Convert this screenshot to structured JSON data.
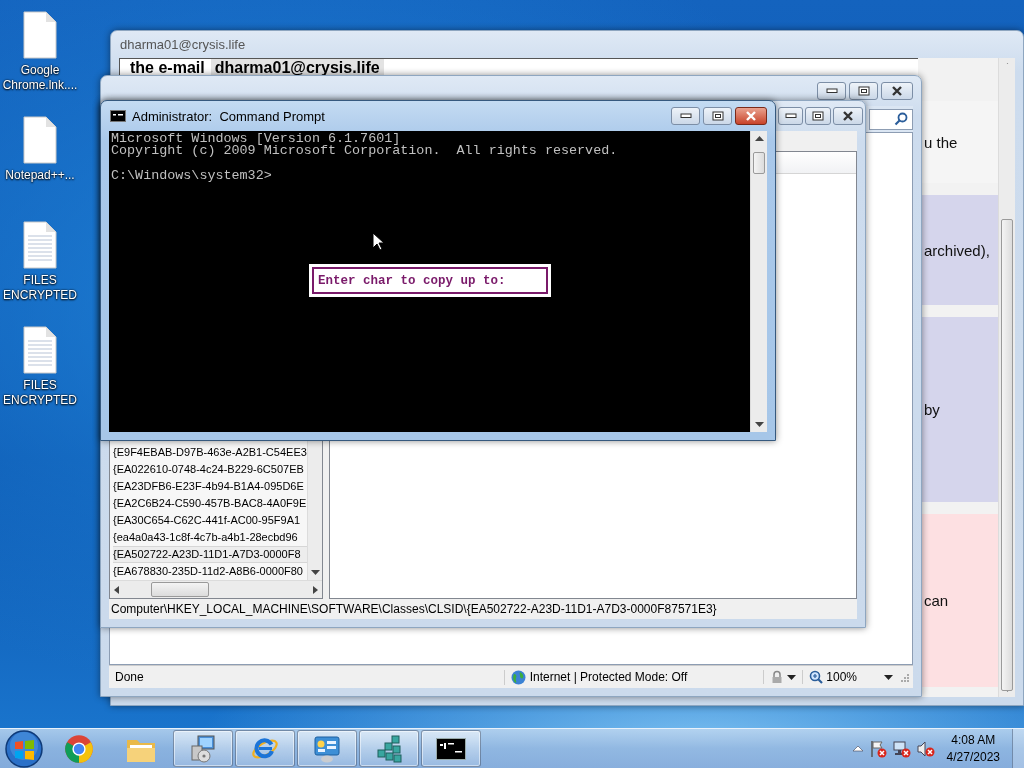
{
  "desktop_icons": [
    {
      "label": "Google Chrome.lnk....",
      "kind": "file"
    },
    {
      "label": "Notepad++...",
      "kind": "file"
    },
    {
      "label": "FILES ENCRYPTED",
      "kind": "text"
    },
    {
      "label": "FILES ENCRYPTED",
      "kind": "text"
    }
  ],
  "page_window": {
    "title": "dharma01@crysis.life",
    "banner_label": "the e-mail",
    "banner_email": "dharma01@crysis.life",
    "fragments": [
      {
        "text": "u the",
        "color": "#f5f5f5"
      },
      {
        "text": "archived),",
        "color": "#d5d5ec"
      },
      {
        "text": "by",
        "color": "#d5d5ec"
      },
      {
        "text": "can",
        "color": "#fde0e2"
      }
    ]
  },
  "browser_window": {
    "status": "Done",
    "zone": "Internet | Protected Mode: Off",
    "zoom": "100%"
  },
  "registry_window": {
    "keys": [
      {
        "name": "{E9F4EBAB-D97B-463e-A2B1-C54EE3",
        "selected": false
      },
      {
        "name": "{EA022610-0748-4c24-B229-6C507EB",
        "selected": false
      },
      {
        "name": "{EA23DFB6-E23F-4b94-B1A4-095D6E",
        "selected": false
      },
      {
        "name": "{EA2C6B24-C590-457B-BAC8-4A0F9E",
        "selected": false
      },
      {
        "name": "{EA30C654-C62C-441f-AC00-95F9A1",
        "selected": false
      },
      {
        "name": "{ea4a0a43-1c8f-4c7b-a4b1-28ecbd96",
        "selected": false
      },
      {
        "name": "{EA502722-A23D-11D1-A7D3-0000F8",
        "selected": true
      },
      {
        "name": "{EA678830-235D-11d2-A8B6-0000F80",
        "selected": false
      }
    ],
    "path": "Computer\\HKEY_LOCAL_MACHINE\\SOFTWARE\\Classes\\CLSID\\{EA502722-A23D-11D1-A7D3-0000F87571E3}"
  },
  "console_window": {
    "title": "Administrator:  Command Prompt",
    "active": true,
    "lines": [
      "Microsoft Windows [Version 6.1.7601]",
      "Copyright (c) 2009 Microsoft Corporation.  All rights reserved."
    ],
    "prompt": "C:\\Windows\\system32>",
    "popup": "Enter char to copy up to:"
  },
  "taskbar": {
    "buttons": [
      {
        "kind": "chrome",
        "running": false
      },
      {
        "kind": "folder",
        "running": false
      },
      {
        "kind": "installer",
        "running": true
      },
      {
        "kind": "ie",
        "running": true
      },
      {
        "kind": "control-panel",
        "running": true
      },
      {
        "kind": "registry",
        "running": true
      },
      {
        "kind": "console",
        "running": true
      }
    ],
    "clock_time": "4:08 AM",
    "clock_date": "4/27/2023"
  }
}
